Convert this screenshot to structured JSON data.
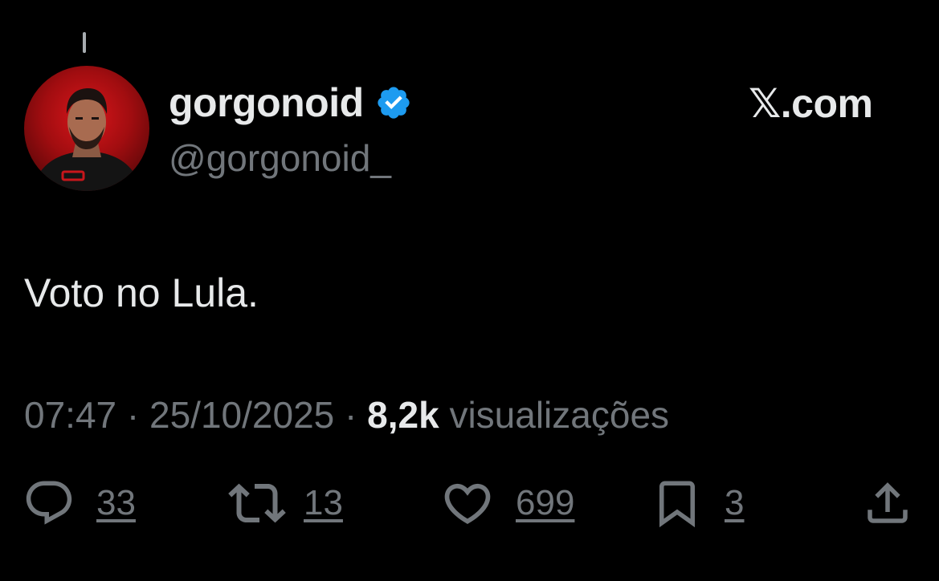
{
  "user": {
    "display_name": "gorgonoid",
    "handle": "@gorgonoid_",
    "verified": true
  },
  "brand": "𝕏.com",
  "tweet": {
    "text": "Voto no Lula."
  },
  "meta": {
    "time": "07:47",
    "separator": " · ",
    "date": "25/10/2025",
    "views_count": "8,2k",
    "views_label": " visualizações"
  },
  "actions": {
    "replies": "33",
    "reposts": "13",
    "likes": "699",
    "bookmarks": "3"
  },
  "icons": {
    "reply": "reply-icon",
    "repost": "repost-icon",
    "like": "like-icon",
    "bookmark": "bookmark-icon",
    "share": "share-icon",
    "verified": "verified-badge-icon"
  },
  "colors": {
    "background": "#000000",
    "text_primary": "#e7e9ea",
    "text_secondary": "#71767b",
    "verified_blue": "#1d9bf0"
  }
}
